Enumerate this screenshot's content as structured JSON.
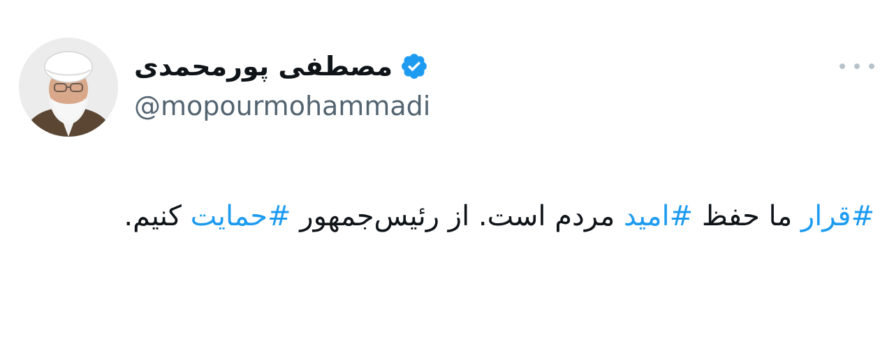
{
  "user": {
    "display_name": "مصطفی پورمحمدی",
    "handle": "@mopourmohammadi",
    "verified": true
  },
  "icons": {
    "verified": "verified-badge-icon",
    "more": "more-options-icon"
  },
  "tweet": {
    "segments": [
      {
        "type": "hashtag",
        "text": "#قرار"
      },
      {
        "type": "text",
        "text": " ما حفظ "
      },
      {
        "type": "hashtag",
        "text": "#امید"
      },
      {
        "type": "text",
        "text": " مردم است. از رئیس‌جمهور "
      },
      {
        "type": "hashtag",
        "text": "#حمایت"
      },
      {
        "type": "text",
        "text": " کنیم."
      }
    ]
  },
  "colors": {
    "text": "#0f1419",
    "secondary": "#536471",
    "accent": "#1d9bf0"
  }
}
